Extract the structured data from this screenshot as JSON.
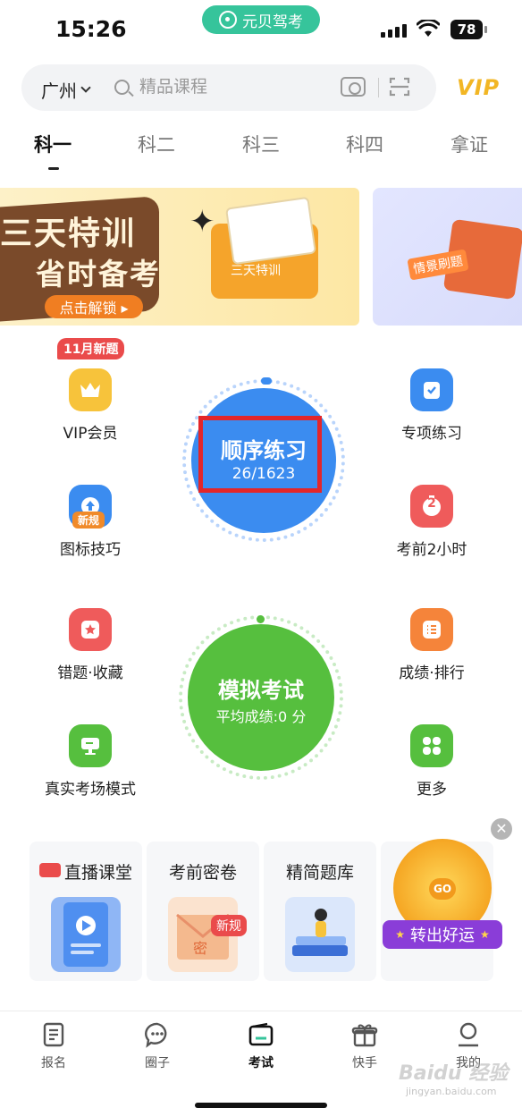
{
  "status_bar": {
    "time": "15:26",
    "app_name": "元贝驾考",
    "battery": "78"
  },
  "search": {
    "city": "广州",
    "placeholder": "精品课程"
  },
  "vip_label": "VIP",
  "tabs": [
    {
      "label": "科一",
      "active": true
    },
    {
      "label": "科二",
      "active": false
    },
    {
      "label": "科三",
      "active": false
    },
    {
      "label": "科四",
      "active": false
    },
    {
      "label": "拿证",
      "active": false
    }
  ],
  "banners": {
    "main_line1": "三天特训",
    "main_line2": "省时备考",
    "main_button": "点击解锁 ▸",
    "main_folder_label": "三天特训",
    "side_tag": "情景刷题"
  },
  "grid": {
    "new_badge": "11月新题",
    "vip": "VIP会员",
    "special": "专项练习",
    "sign_tips": "图标技巧",
    "sign_tips_badge": "新规",
    "two_hours": "考前2小时",
    "two_hours_icon": "2",
    "mistakes": "错题·收藏",
    "scores": "成绩·排行",
    "real_exam": "真实考场模式",
    "more": "更多"
  },
  "practice": {
    "title": "顺序练习",
    "progress": "26/1623"
  },
  "mock_exam": {
    "title": "模拟考试",
    "average": "平均成绩:0 分"
  },
  "cards": {
    "live": "直播课堂",
    "secret": "考前密卷",
    "secret_badge": "新规",
    "secret_seal": "密",
    "concise": "精简题库",
    "luck_button": "转出好运",
    "wheel_go": "GO"
  },
  "bottom_nav": [
    {
      "label": "报名",
      "icon": "document-icon",
      "active": false
    },
    {
      "label": "圈子",
      "icon": "chat-bubble-icon",
      "active": false
    },
    {
      "label": "考试",
      "icon": "wallet-icon",
      "active": true
    },
    {
      "label": "快手",
      "icon": "gift-icon",
      "active": false
    },
    {
      "label": "我的",
      "icon": "person-icon",
      "active": false
    }
  ],
  "watermark": {
    "brand": "Baidu 经验",
    "url": "jingyan.baidu.com"
  },
  "colors": {
    "brand_green": "#36c49b",
    "practice_blue": "#3b8cf0",
    "exam_green": "#56bf3e",
    "highlight_red": "#e3262a",
    "vip_gold": "#f2b624"
  }
}
